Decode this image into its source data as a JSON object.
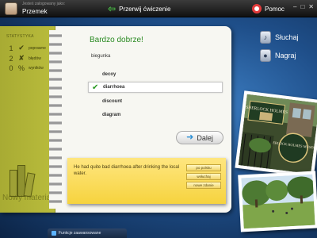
{
  "topbar": {
    "user_caption": "Jesteś zalogowany jako:",
    "user_name": "Przemek",
    "stop_label": "Przerwij ćwiczenie",
    "help_label": "Pomoc",
    "window_buttons": [
      "–",
      "□",
      "✕"
    ]
  },
  "stats": {
    "title": "STATYSTYKA",
    "items": [
      {
        "count": "1",
        "symbol": "✔",
        "label": "poprawne"
      },
      {
        "count": "2",
        "symbol": "✘",
        "label": "błędów"
      },
      {
        "count": "0",
        "symbol": "%",
        "label": "wyników"
      }
    ],
    "new_material": "Nowy materiał"
  },
  "exercise": {
    "feedback": "Bardzo dobrze!",
    "question": "biegunka",
    "options": [
      {
        "label": "decoy",
        "selected": false
      },
      {
        "label": "diarrhoea",
        "selected": true
      },
      {
        "label": "discount",
        "selected": false
      },
      {
        "label": "diagram",
        "selected": false
      }
    ],
    "next_label": "Dalej"
  },
  "sticky": {
    "sentence": "He had quite bad diarrhoea after drinking the local water.",
    "buttons": [
      "po polsku",
      "wsłuchaj",
      "nowe zdanie"
    ]
  },
  "side": {
    "listen_label": "Słuchaj",
    "record_label": "Nagraj"
  },
  "photos": {
    "sign_top": "SHERLOCK HOLMES",
    "sign_bottom": "SHERLOCK HOLMES MUSEUM"
  },
  "bottom": {
    "advanced_label": "Funkcje zaawansowane"
  },
  "colors": {
    "accent_green": "#2a8a22",
    "stats_green": "#b9bc3c",
    "sticky_yellow": "#f6d33e",
    "next_arrow": "#2d8fd4"
  }
}
